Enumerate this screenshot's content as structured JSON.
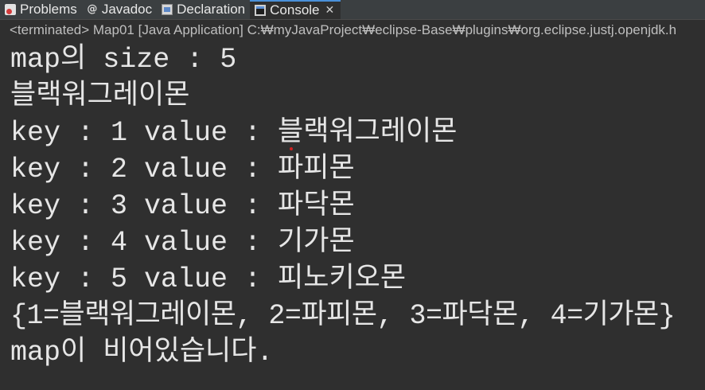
{
  "tabs": [
    {
      "label": "Problems",
      "icon": "problems-icon",
      "active": false
    },
    {
      "label": "Javadoc",
      "icon": "javadoc-icon",
      "active": false
    },
    {
      "label": "Declaration",
      "icon": "declaration-icon",
      "active": false
    },
    {
      "label": "Console",
      "icon": "console-icon",
      "active": true
    }
  ],
  "close_glyph": "✕",
  "status_line": "<terminated> Map01 [Java Application] C:₩myJavaProject₩eclipse-Base₩plugins₩org.eclipse.justj.openjdk.h",
  "console_lines": [
    "map의 size : 5",
    "블랙워그레이몬",
    "key : 1 value : 블랙워그레이몬",
    "key : 2 value : 파피몬",
    "key : 3 value : 파닥몬",
    "key : 4 value : 기가몬",
    "key : 5 value : 피노키오몬",
    "{1=블랙워그레이몬, 2=파피몬, 3=파닥몬, 4=기가몬}",
    "map이 비어있습니다."
  ],
  "colors": {
    "background": "#2f2f2f",
    "tabbar": "#3b3f41",
    "text": "#e6e6e6",
    "accent": "#4a90d9"
  }
}
